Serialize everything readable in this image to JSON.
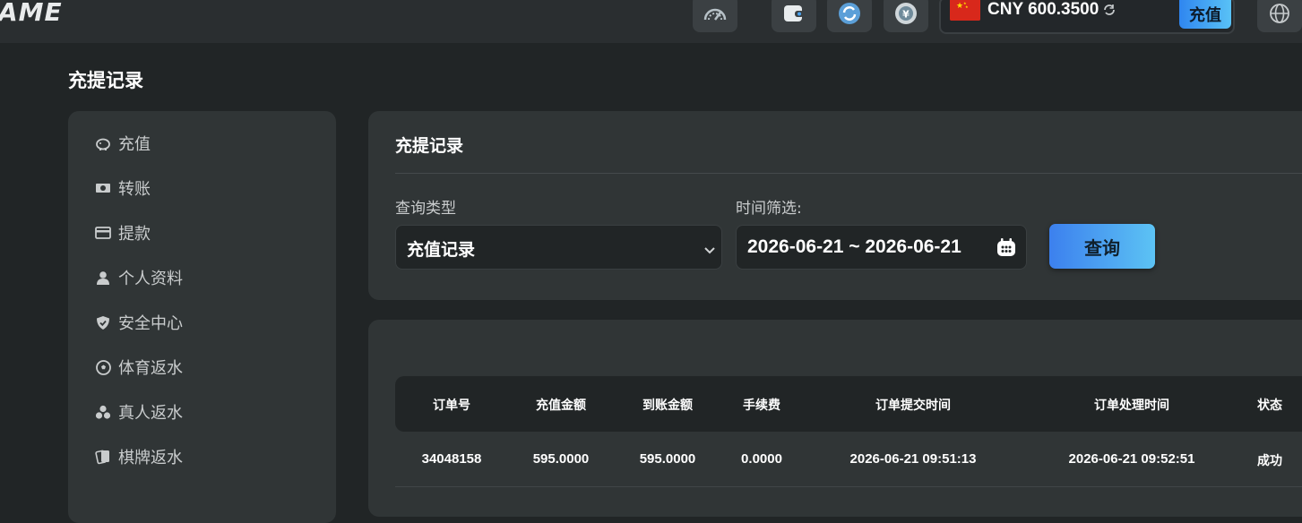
{
  "header": {
    "logo": "AME",
    "currency": "CNY",
    "balance": "600.3500",
    "deposit_label": "充值"
  },
  "page": {
    "title": "充提记录"
  },
  "sidebar": {
    "items": [
      {
        "label": "充值",
        "icon": "piggy-bank-icon"
      },
      {
        "label": "转账",
        "icon": "money-bill-icon"
      },
      {
        "label": "提款",
        "icon": "wallet-card-icon"
      },
      {
        "label": "个人资料",
        "icon": "user-icon"
      },
      {
        "label": "安全中心",
        "icon": "shield-icon"
      },
      {
        "label": "体育返水",
        "icon": "soccer-ball-icon"
      },
      {
        "label": "真人返水",
        "icon": "chips-icon"
      },
      {
        "label": "棋牌返水",
        "icon": "cards-icon"
      }
    ]
  },
  "filter": {
    "title": "充提记录",
    "type_label": "查询类型",
    "type_value": "充值记录",
    "time_label": "时间筛选:",
    "date_range": "2026-06-21 ~ 2026-06-21",
    "query_label": "查询"
  },
  "table": {
    "headers": [
      "订单号",
      "充值金额",
      "到账金额",
      "手续费",
      "订单提交时间",
      "订单处理时间",
      "状态"
    ],
    "rows": [
      [
        "34048158",
        "595.0000",
        "595.0000",
        "0.0000",
        "2026-06-21 09:51:13",
        "2026-06-21 09:52:51",
        "成功"
      ]
    ]
  },
  "colors": {
    "background": "#212526",
    "panel": "#303536",
    "accent_start": "#2f86f0",
    "accent_end": "#59c2f6"
  }
}
